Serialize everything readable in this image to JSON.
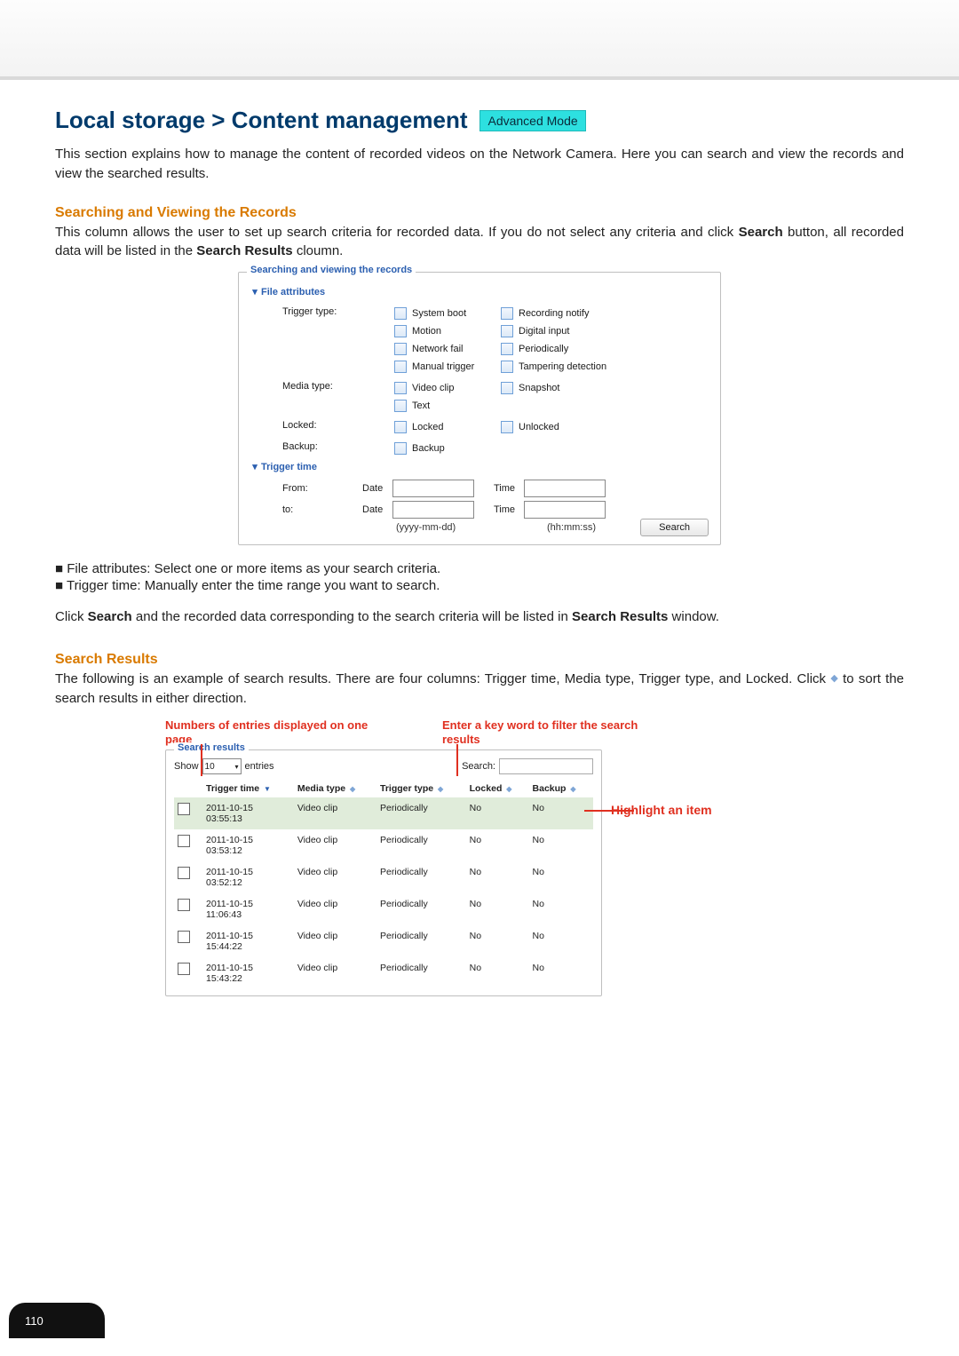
{
  "pageNumber": "110",
  "title": "Local storage > Content management",
  "advancedMode": "Advanced Mode",
  "intro": "This section explains how to manage the content of recorded videos on the Network Camera. Here you can search and view the records and view the searched results.",
  "sec1": {
    "heading": "Searching and Viewing the Records",
    "para": "This column allows the user to set up search criteria for recorded data. If you do not select any criteria and click Search button, all recorded data will be listed in the Search Results cloumn."
  },
  "searchPanel": {
    "legend": "Searching and viewing the records",
    "fileAttributes": "File attributes",
    "triggerTypeLabel": "Trigger type:",
    "triggerTypes": {
      "c0": "System boot",
      "c1": "Recording notify",
      "c2": "Motion",
      "c3": "Digital input",
      "c4": "Network fail",
      "c5": "Periodically",
      "c6": "Manual trigger",
      "c7": "Tampering detection"
    },
    "mediaTypeLabel": "Media type:",
    "mediaTypes": {
      "c0": "Video clip",
      "c1": "Snapshot",
      "c2": "Text"
    },
    "lockedLabel": "Locked:",
    "lockedOpts": {
      "c0": "Locked",
      "c1": "Unlocked"
    },
    "backupLabel": "Backup:",
    "backupOpts": {
      "c0": "Backup"
    },
    "triggerTime": "Trigger time",
    "fromLabel": "From:",
    "toLabel": "to:",
    "dateLabel": "Date",
    "timeLabel": "Time",
    "dateHint": "(yyyy-mm-dd)",
    "timeHint": "(hh:mm:ss)",
    "searchBtn": "Search"
  },
  "bullets": {
    "b0": "■ File attributes: Select one or more items as your search criteria.",
    "b1": "■ Trigger time: Manually enter the time range you want to search."
  },
  "clickSearch": {
    "pre": "Click ",
    "bold1": "Search",
    "mid": " and the recorded data corresponding to the search criteria will be listed in ",
    "bold2": "Search Results",
    "post": " window."
  },
  "sec2": {
    "heading": "Search Results",
    "para": "The following is an example of search results. There are four columns: Trigger time, Media type, Trigger type, and Locked. Click  to sort the search results in either direction."
  },
  "annot": {
    "left": "Numbers of entries displayed on one page",
    "right": "Enter a key word to filter the search results",
    "highlight": "Highlight an item"
  },
  "results": {
    "legend": "Search results",
    "showLabel": "Show",
    "showValue": "10",
    "entriesLabel": "entries",
    "searchLabel": "Search:",
    "cols": {
      "c0": "Trigger time",
      "c1": "Media type",
      "c2": "Trigger type",
      "c3": "Locked",
      "c4": "Backup"
    },
    "rows": [
      {
        "time": "2011-10-15 03:55:13",
        "media": "Video clip",
        "trigger": "Periodically",
        "locked": "No",
        "backup": "No"
      },
      {
        "time": "2011-10-15 03:53:12",
        "media": "Video clip",
        "trigger": "Periodically",
        "locked": "No",
        "backup": "No"
      },
      {
        "time": "2011-10-15 03:52:12",
        "media": "Video clip",
        "trigger": "Periodically",
        "locked": "No",
        "backup": "No"
      },
      {
        "time": "2011-10-15 11:06:43",
        "media": "Video clip",
        "trigger": "Periodically",
        "locked": "No",
        "backup": "No"
      },
      {
        "time": "2011-10-15 15:44:22",
        "media": "Video clip",
        "trigger": "Periodically",
        "locked": "No",
        "backup": "No"
      },
      {
        "time": "2011-10-15 15:43:22",
        "media": "Video clip",
        "trigger": "Periodically",
        "locked": "No",
        "backup": "No"
      }
    ]
  }
}
